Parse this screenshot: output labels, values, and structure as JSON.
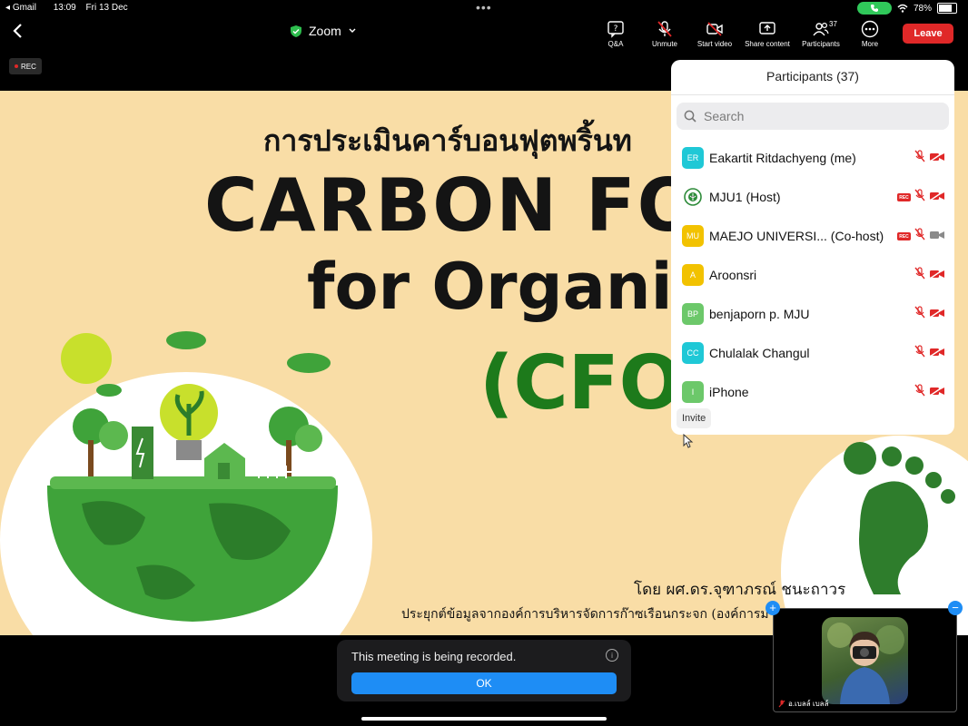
{
  "status_bar": {
    "back_app": "Gmail",
    "time": "13:09",
    "date": "Fri 13 Dec",
    "battery": "78%",
    "battery_level": 0.78
  },
  "meeting": {
    "title": "Zoom"
  },
  "toolbar": {
    "qa": "Q&A",
    "unmute": "Unmute",
    "start_video": "Start video",
    "share": "Share content",
    "participants": "Participants",
    "participants_count": "37",
    "more": "More",
    "leave": "Leave"
  },
  "rec_badge": "REC",
  "slide": {
    "thai_title": "การประเมินคาร์บอนฟุตพริ้นท",
    "title_line1": "CARBON FOO",
    "title_line2": "for Organiz",
    "acronym": "(CFO)",
    "byline": "โดย ผศ.ดร.จุฑาภรณ์ ชนะถาวร",
    "applied": "ประยุกต์ข้อมูลจากองค์การบริหารจัดการก๊าซเรือนกระจก (องค์การม"
  },
  "participants_panel": {
    "title": "Participants (37)",
    "search_placeholder": "Search",
    "invite": "Invite",
    "rows": [
      {
        "initials": "ER",
        "name": "Eakartit Ritdachyeng (me)",
        "color": "#1fc8d6",
        "rec": false,
        "video_on": false
      },
      {
        "initials": "",
        "name": "MJU1 (Host)",
        "color": "#2e8b3a",
        "rec": true,
        "video_on": false
      },
      {
        "initials": "MU",
        "name": "MAEJO UNIVERSI... (Co-host)",
        "color": "#f2c200",
        "rec": true,
        "video_on": true
      },
      {
        "initials": "A",
        "name": "Aroonsri",
        "color": "#f2c200",
        "rec": false,
        "video_on": false
      },
      {
        "initials": "BP",
        "name": "benjaporn p. MJU",
        "color": "#6cc86a",
        "rec": false,
        "video_on": false
      },
      {
        "initials": "CC",
        "name": "Chulalak Changul",
        "color": "#1fc8d6",
        "rec": false,
        "video_on": false
      },
      {
        "initials": "I",
        "name": "iPhone",
        "color": "#6cc86a",
        "rec": false,
        "video_on": false
      }
    ]
  },
  "toast": {
    "message": "This meeting is being recorded.",
    "ok": "OK"
  },
  "self_view": {
    "name": "อ.เบลล์ เบลล์"
  },
  "colors": {
    "accent": "#1e8df5",
    "leave": "#e02828",
    "mute": "#e02828"
  }
}
